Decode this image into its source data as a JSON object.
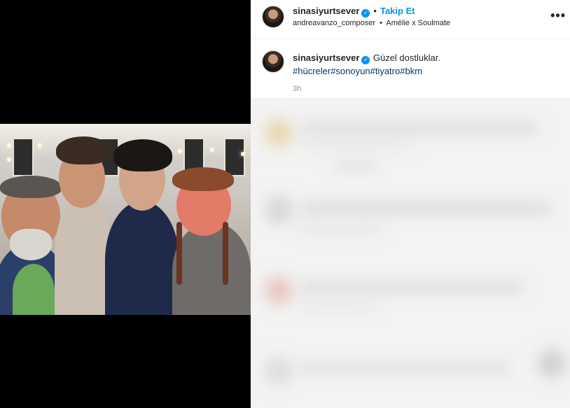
{
  "post": {
    "author": {
      "username": "sinasiyurtsever",
      "verified_mark": "✓",
      "separator": "•",
      "follow_label": "Takip Et"
    },
    "audio": {
      "artist": "andreavanzo_composer",
      "separator": "•",
      "track": "Amélie x Soulmate"
    },
    "more_icon": "•••",
    "caption": {
      "username": "sinasiyurtsever",
      "text": "Güzel dostluklar.",
      "hashtags": [
        "#hücreler",
        "#sonoyun",
        "#tiyatro",
        "#bkm"
      ],
      "time": "3h"
    }
  },
  "colors": {
    "accent": "#0095f6",
    "hashtag": "#00376b",
    "muted": "#8e8e8e",
    "media_bg": "#000000"
  },
  "icons": [
    "verified-badge-icon",
    "more-options-icon",
    "avatar"
  ]
}
